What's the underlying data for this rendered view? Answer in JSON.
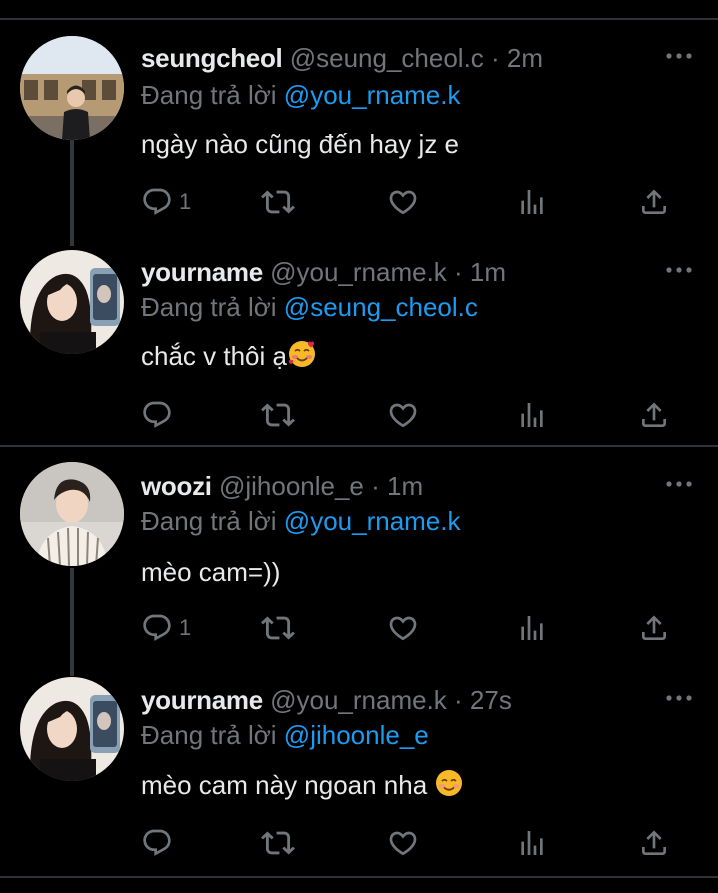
{
  "tweets": [
    {
      "name": "seungcheol",
      "handle": "@seung_cheol.c",
      "time": "· 2m",
      "reply_prefix": "Đang trả lời",
      "reply_to": "@you_rname.k",
      "text": "ngày nào cũng đến hay jz e",
      "reply_count": "1"
    },
    {
      "name": "yourname",
      "handle": "@you_rname.k",
      "time": "· 1m",
      "reply_prefix": "Đang trả lời",
      "reply_to": "@seung_cheol.c",
      "text": "chắc v thôi ạ",
      "reply_count": ""
    },
    {
      "name": "woozi",
      "handle": "@jihoonle_e",
      "time": "· 1m",
      "reply_prefix": "Đang trả lời",
      "reply_to": "@you_rname.k",
      "text": "mèo cam=))",
      "reply_count": "1"
    },
    {
      "name": "yourname",
      "handle": "@you_rname.k",
      "time": "· 27s",
      "reply_prefix": "Đang trả lời",
      "reply_to": "@jihoonle_e",
      "text": "mèo cam này ngoan nha",
      "reply_count": ""
    }
  ],
  "icons": {
    "reply": "reply-icon",
    "retweet": "retweet-icon",
    "like": "heart-icon",
    "views": "views-icon",
    "share": "share-icon",
    "more": "more-icon"
  },
  "colors": {
    "background": "#000000",
    "text": "#e7e9ea",
    "muted": "#71767b",
    "mention": "#1d9bf0",
    "divider": "#2f3336"
  }
}
